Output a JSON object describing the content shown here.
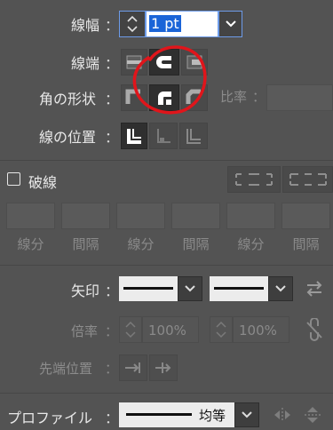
{
  "stroke": {
    "weight_label": "線幅",
    "weight_value": "1 pt",
    "cap_label": "線端",
    "corner_label": "角の形状",
    "limit_label": "比率",
    "align_label": "線の位置",
    "colon": "："
  },
  "dashed": {
    "label": "破線",
    "fields": [
      "線分",
      "間隔",
      "線分",
      "間隔",
      "線分",
      "間隔"
    ]
  },
  "arrow": {
    "label": "矢印",
    "scale_label": "倍率",
    "scale_start": "100%",
    "scale_end": "100%",
    "align_label": "先端位置"
  },
  "profile": {
    "label": "プロファイル",
    "value": "均等"
  },
  "colors": {
    "annotation": "#e0151b",
    "focus": "#6d9be8",
    "selection": "#1a64d8"
  }
}
